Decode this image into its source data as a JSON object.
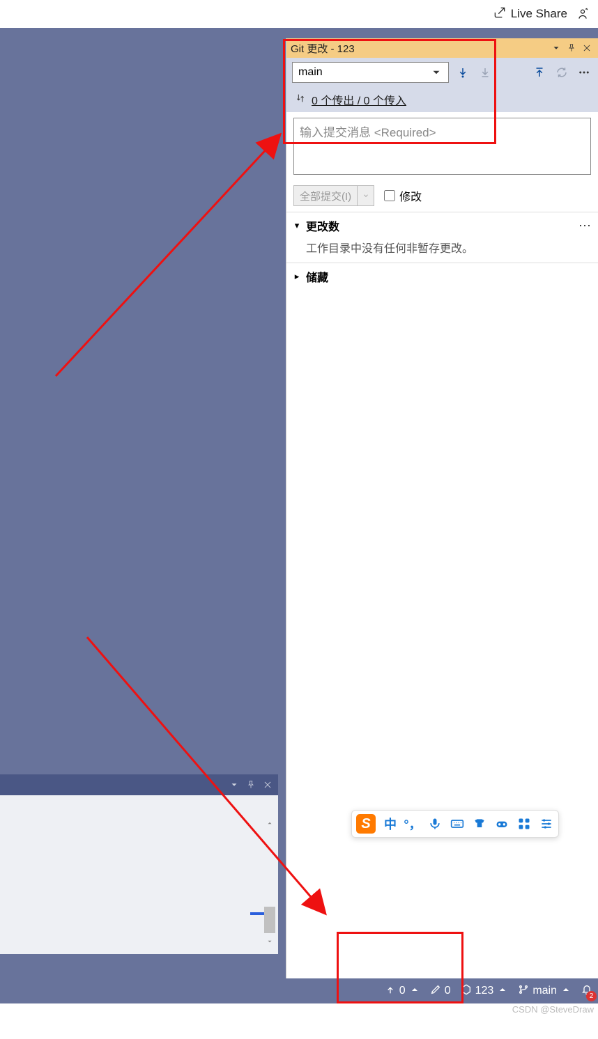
{
  "top": {
    "live_share": "Live Share"
  },
  "git_panel": {
    "title": "Git 更改 - 123",
    "branch": "main",
    "sync_status": "0 个传出 / 0 个传入",
    "commit_placeholder": "输入提交消息 <Required>",
    "commit_all": "全部提交(I)",
    "amend": "修改",
    "changes_section": "更改数",
    "changes_empty": "工作目录中没有任何非暂存更改。",
    "stash_section": "储藏"
  },
  "ime": {
    "logo": "S",
    "zhong": "中"
  },
  "status": {
    "push_count": "0",
    "pencil_count": "0",
    "repo_name": "123",
    "branch": "main",
    "notifications": "2"
  },
  "watermark": "CSDN @SteveDraw"
}
